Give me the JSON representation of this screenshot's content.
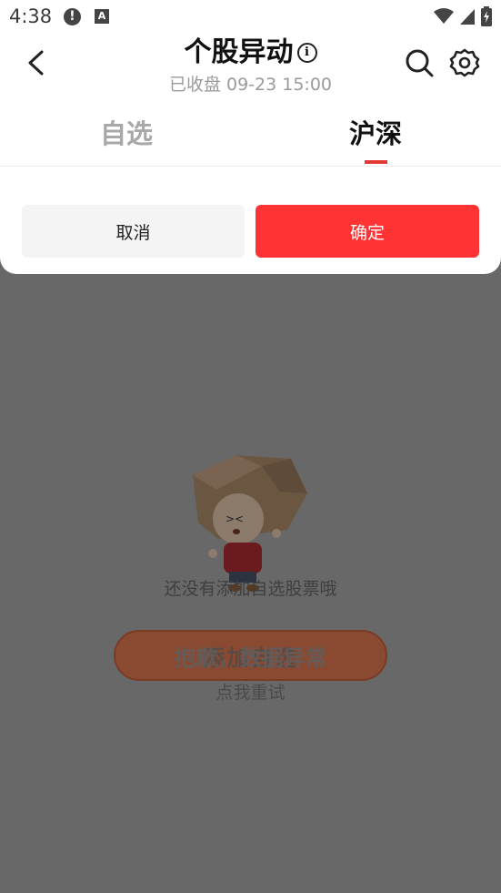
{
  "status_bar": {
    "time": "4:38",
    "alert_icon": "alert-icon",
    "a_icon": "a-icon",
    "wifi_icon": "wifi-icon",
    "signal_icon": "signal-icon",
    "battery_icon": "battery-icon"
  },
  "header": {
    "title": "个股异动",
    "info_glyph": "i",
    "subtitle": "已收盘 09-23 15:00"
  },
  "tabs": [
    {
      "label": "自选",
      "active": false
    },
    {
      "label": "沪深",
      "active": true
    }
  ],
  "dialog": {
    "cancel_label": "取消",
    "confirm_label": "确定"
  },
  "background": {
    "empty_text": "还没有添加自选股票哦",
    "add_button_label": "添加自选",
    "error_text": "抱歉，数据异常",
    "retry_text": "点我重试"
  },
  "colors": {
    "accent": "#ff3333",
    "tab_underline": "#e53935",
    "overlay": "#686868"
  }
}
